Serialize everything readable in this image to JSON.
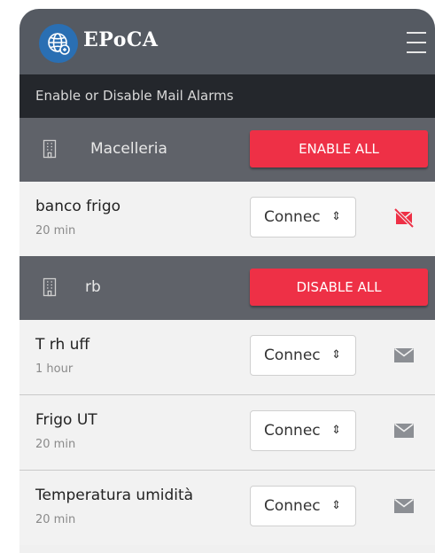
{
  "app": {
    "title": "EPoCA"
  },
  "subheader": "Enable or Disable Mail Alarms",
  "groups": [
    {
      "name": "Macelleria",
      "button_label": "ENABLE ALL"
    },
    {
      "name": "rb",
      "button_label": "DISABLE ALL"
    }
  ],
  "devices": [
    {
      "name": "banco frigo",
      "interval": "20 min",
      "status": "Connec",
      "mail": "disabled"
    },
    {
      "name": "T rh uff",
      "interval": "1 hour",
      "status": "Connec",
      "mail": "enabled"
    },
    {
      "name": "Frigo UT",
      "interval": "20 min",
      "status": "Connec",
      "mail": "enabled"
    },
    {
      "name": "Temperatura umidità",
      "interval": "20 min",
      "status": "Connec",
      "mail": "enabled"
    }
  ],
  "select_arrows": "⇕",
  "colors": {
    "header": "#555a62",
    "subbar": "#24272c",
    "group": "#5f6269",
    "accent_red": "#ee3046",
    "logo_blue": "#2a6fb3",
    "mail_enabled": "#8c8f94"
  },
  "icons": {
    "logo": "globe-icon",
    "menu": "hamburger-menu-icon",
    "group": "building-icon",
    "mail_enabled": "envelope-icon",
    "mail_disabled": "envelope-slash-icon"
  }
}
